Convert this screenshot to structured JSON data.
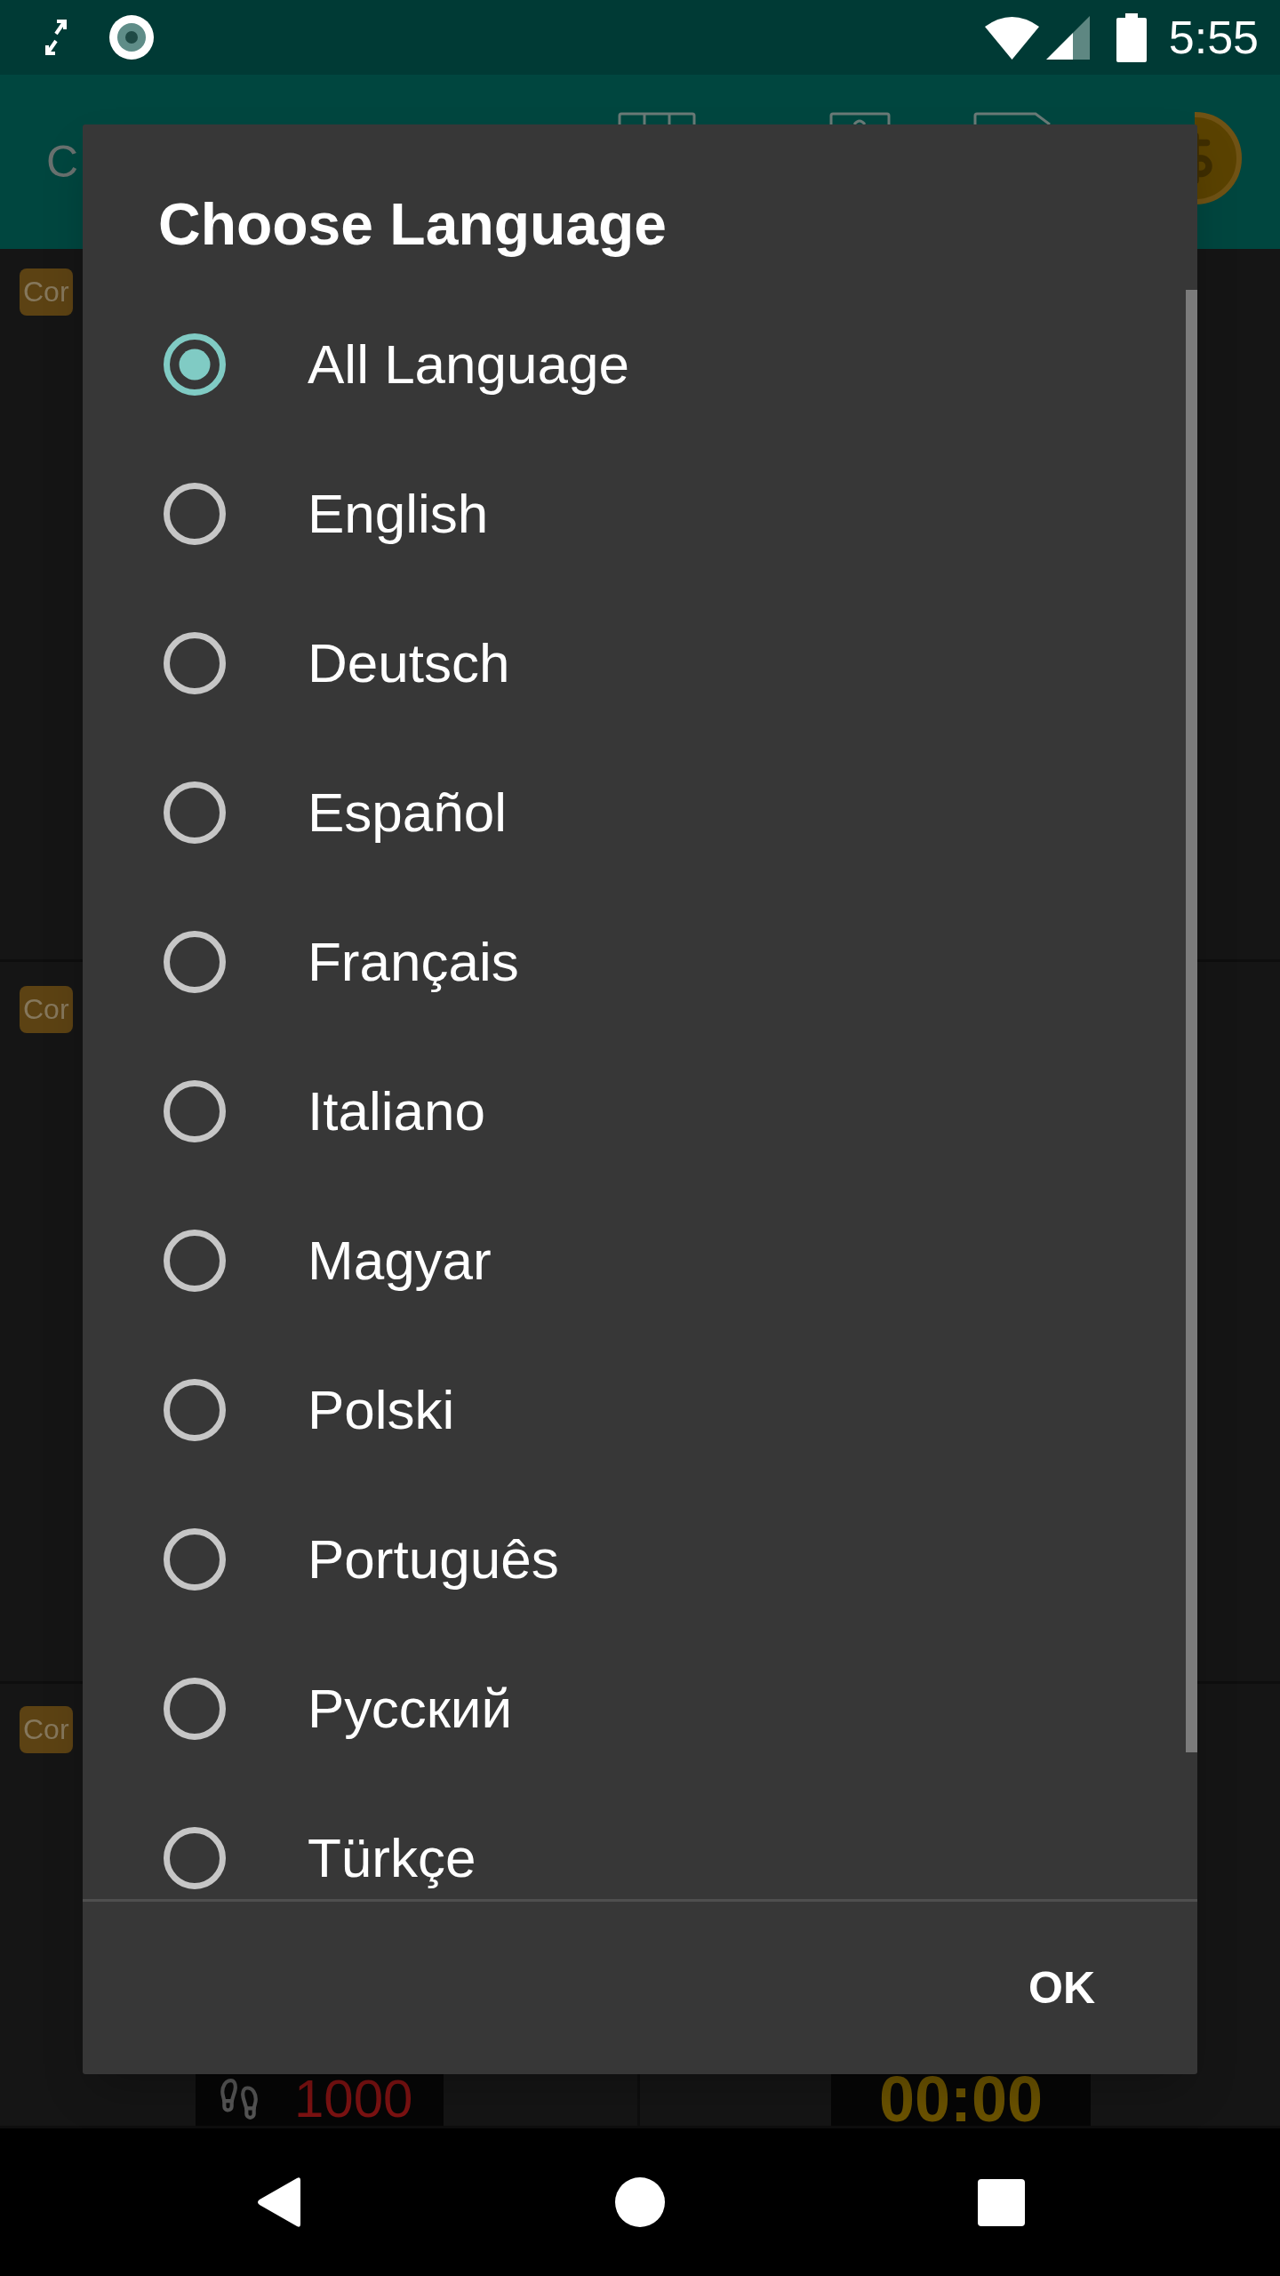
{
  "status_bar": {
    "time": "5:55"
  },
  "app_bar": {
    "title": "C"
  },
  "cards": [
    {
      "badge": "Cor"
    },
    {
      "badge": "Cor"
    },
    {
      "badge": "Cor",
      "tiles": [
        {
          "kind": "steps",
          "reading": "1000"
        },
        {
          "kind": "timer",
          "reading": "00:00"
        }
      ]
    }
  ],
  "dialog": {
    "title": "Choose Language",
    "options": [
      {
        "label": "All Language",
        "selected": true
      },
      {
        "label": "English",
        "selected": false
      },
      {
        "label": "Deutsch",
        "selected": false
      },
      {
        "label": "Español",
        "selected": false
      },
      {
        "label": "Français",
        "selected": false
      },
      {
        "label": "Italiano",
        "selected": false
      },
      {
        "label": "Magyar",
        "selected": false
      },
      {
        "label": "Polski",
        "selected": false
      },
      {
        "label": "Português",
        "selected": false
      },
      {
        "label": "Русский",
        "selected": false
      },
      {
        "label": "Türkçe",
        "selected": false
      }
    ],
    "buttons": [
      "OK"
    ]
  }
}
